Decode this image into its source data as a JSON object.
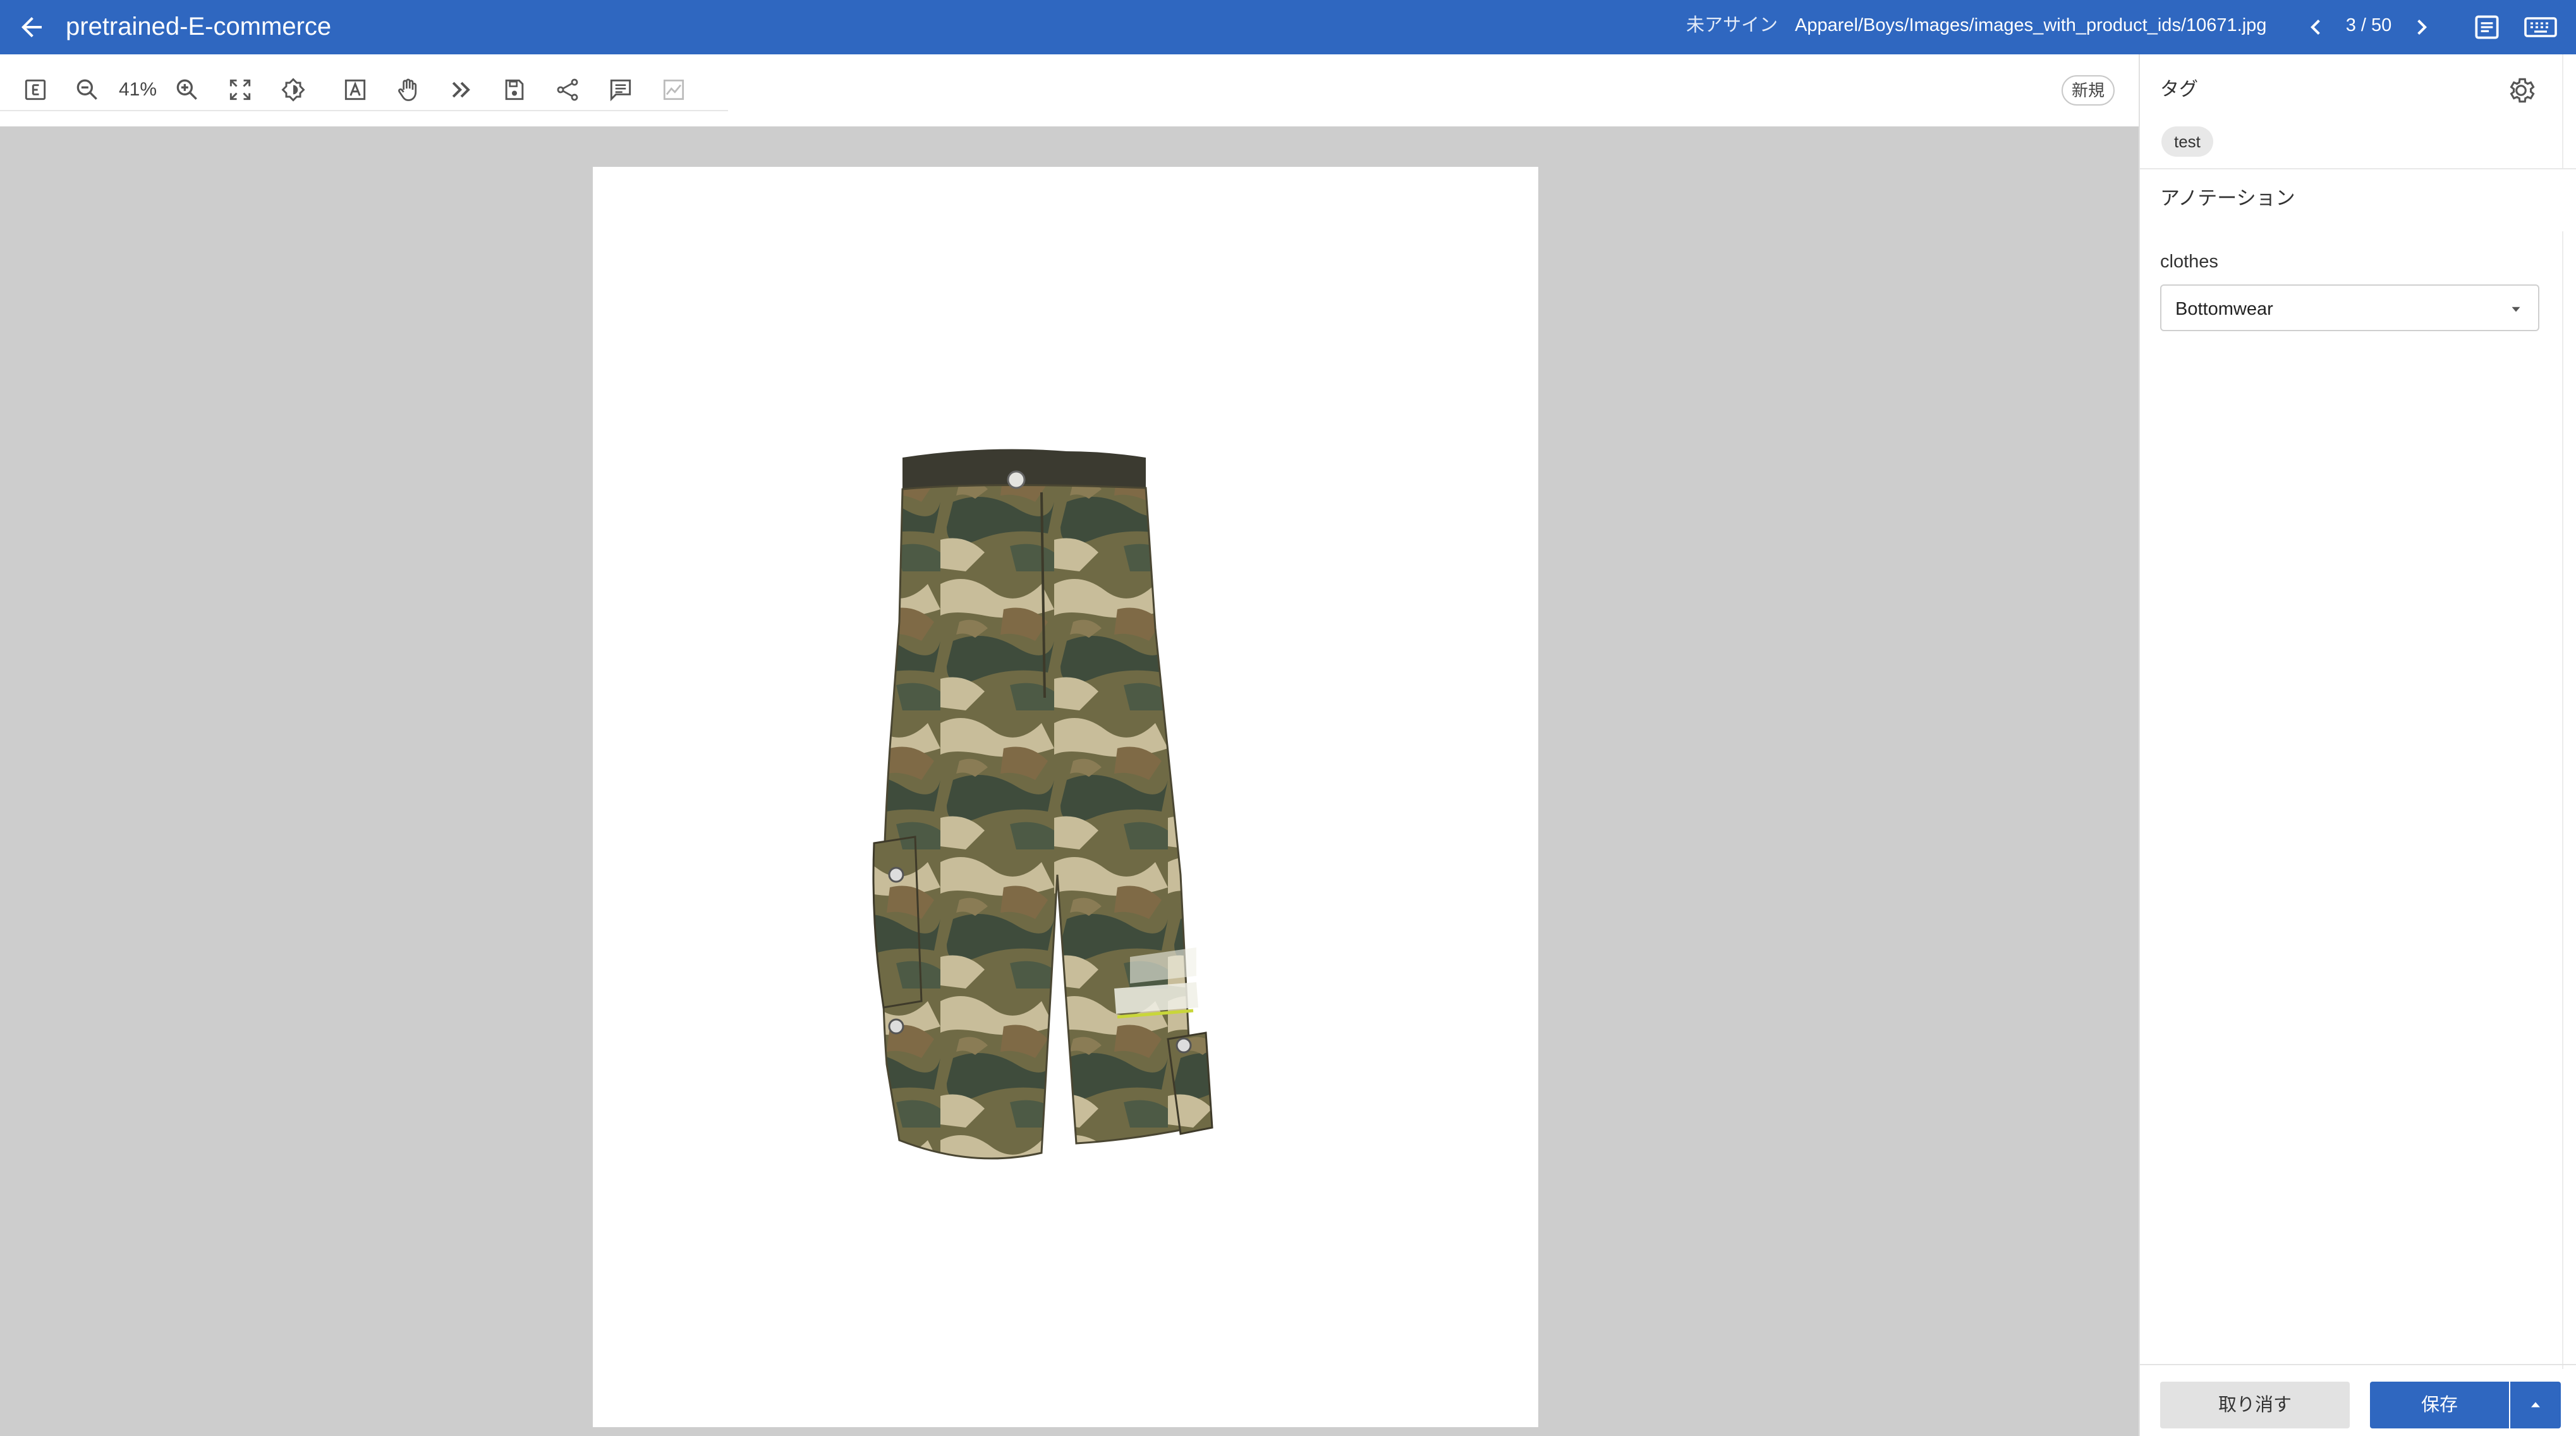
{
  "header": {
    "title": "pretrained-E-commerce",
    "assignee": "未アサイン",
    "file_path": "Apparel/Boys/Images/images_with_product_ids/10671.jpg",
    "counter": "3 / 50"
  },
  "toolbar": {
    "zoom": "41%",
    "status_badge": "新規",
    "icons": [
      "e-icon",
      "zoom-out-icon",
      "zoom-in-icon",
      "fit-screen-icon",
      "brightness-icon",
      "text-box-icon",
      "pan-hand-icon",
      "skip-icon",
      "save-icon",
      "share-icon",
      "comment-icon",
      "chart-icon"
    ]
  },
  "panel": {
    "tags_heading": "タグ",
    "tags": [
      "test"
    ],
    "annotation_heading": "アノテーション",
    "field_label": "clothes",
    "field_value": "Bottomwear",
    "cancel_label": "取り消す",
    "save_label": "保存"
  },
  "colors": {
    "appbar": "#2f67c0",
    "canvas": "#cdcdcd",
    "primary_button": "#2f67c0"
  }
}
